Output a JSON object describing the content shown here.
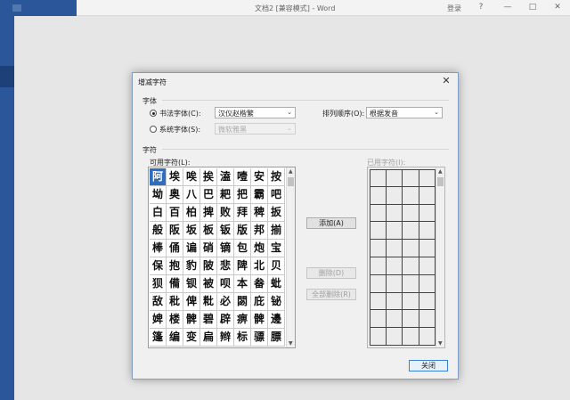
{
  "window": {
    "title": "文档2 [兼容模式] - Word",
    "login": "登录",
    "help": "?",
    "minimize": "—",
    "restore": "□",
    "close": "✕"
  },
  "dialog": {
    "title": "增减字符",
    "close": "✕",
    "font_group": "字体",
    "calligraphy_radio": "书法字体(C):",
    "calligraphy_font": "汉仪赵楷繁",
    "system_radio": "系统字体(S):",
    "system_font": "微软雅黑",
    "sort_label": "排列顺序(O):",
    "sort_value": "根据发音",
    "chars_group": "字符",
    "available_label": "可用字符(L):",
    "selected_label": "已用字符(I):",
    "add_button": "添加(A)",
    "delete_button": "删除(D)",
    "delete_all_button": "全部删除(R)",
    "close_button": "关闭"
  },
  "characters": [
    "阿",
    "埃",
    "唉",
    "挨",
    "溘",
    "噎",
    "安",
    "按",
    "坳",
    "奥",
    "八",
    "巴",
    "耙",
    "把",
    "霸",
    "吧",
    "白",
    "百",
    "柏",
    "捭",
    "败",
    "拜",
    "稗",
    "扳",
    "般",
    "阪",
    "坂",
    "板",
    "钣",
    "版",
    "邦",
    "揃",
    "棒",
    "俑",
    "谝",
    "硝",
    "镝",
    "包",
    "炮",
    "宝",
    "保",
    "抱",
    "豹",
    "陂",
    "悲",
    "陴",
    "北",
    "贝",
    "狈",
    "備",
    "钡",
    "被",
    "呗",
    "本",
    "畚",
    "蚍",
    "敌",
    "秕",
    "俾",
    "粃",
    "必",
    "閟",
    "庇",
    "铋",
    "婢",
    "楼",
    "髀",
    "碧",
    "辟",
    "痹",
    "髀",
    "邊",
    "篷",
    "编",
    "变",
    "扁",
    "辫",
    "标",
    "骠",
    "膘"
  ],
  "colors": {
    "accent": "#2b579a",
    "selected_cell": "#2f6ebd",
    "dialog_border": "#7e9ec6"
  }
}
